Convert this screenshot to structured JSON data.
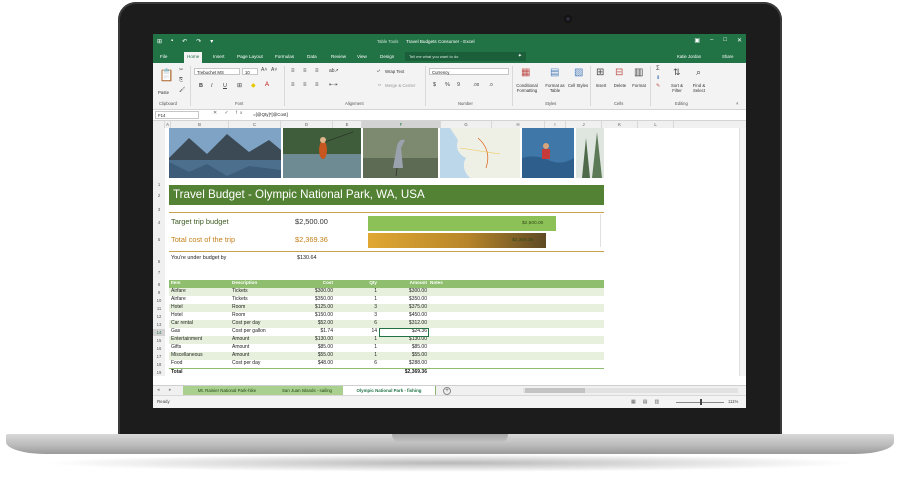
{
  "window": {
    "table_tools": "Table Tools",
    "doc_title": "Travel Budgets Consumer - Excel",
    "user": "Katie Jordan",
    "share": "Share",
    "qat": [
      "⊞",
      "▪",
      "↶",
      "↷",
      "▾"
    ],
    "win_buttons": [
      "▣",
      "–",
      "□",
      "✕"
    ]
  },
  "tabs": [
    "File",
    "Home",
    "Insert",
    "Page Layout",
    "Formulas",
    "Data",
    "Review",
    "View",
    "Design"
  ],
  "active_tab": "Home",
  "tell_me": "Tell me what you want to do",
  "ribbon": {
    "paste": "Paste",
    "font_name": "Trebuchet MS",
    "font_size": "10",
    "font_buttons": [
      "B",
      "I",
      "U"
    ],
    "align_icons": [
      "≡",
      "≡",
      "≡"
    ],
    "wrap_text": "Wrap Text",
    "merge_center": "Merge & Center",
    "number_format": "Currency",
    "number_icons": [
      "$",
      "%",
      "9"
    ],
    "conditional": "Conditional Formatting",
    "format_table": "Format as Table",
    "cell_styles": "Cell Styles",
    "insert": "Insert",
    "delete": "Delete",
    "format": "Format",
    "sort_filter": "Sort & Filter",
    "find_select": "Find & Select",
    "groups": [
      "Clipboard",
      "Font",
      "Alignment",
      "Number",
      "Styles",
      "Cells",
      "Editing"
    ]
  },
  "formula_bar": {
    "name_box": "F14",
    "fx_icons": "✕ ✓ fx",
    "formula": "=[@Qty]*[@Cost]"
  },
  "columns": [
    "A",
    "B",
    "C",
    "D",
    "E",
    "F",
    "G",
    "H",
    "I",
    "J",
    "K",
    "L"
  ],
  "rows": [
    "1",
    "2",
    "3",
    "4",
    "5",
    "6",
    "7",
    "8",
    "9",
    "10",
    "11",
    "12",
    "13",
    "14",
    "15",
    "16",
    "17",
    "18",
    "19"
  ],
  "banner_title": "Travel Budget - Olympic National Park, WA, USA",
  "summary": {
    "target_label": "Target trip budget",
    "target_value": "$2,500.00",
    "total_label": "Total cost of the trip",
    "total_value": "$2,369.36",
    "under_label": "You're under budget by",
    "under_value": "$130.64",
    "bars": [
      {
        "label": "$2,500.00",
        "fraction": 1.0,
        "color": "#8cc157"
      },
      {
        "label": "$2,369.36",
        "fraction": 0.947,
        "color": "#e0a732"
      }
    ]
  },
  "table": {
    "headers": {
      "item": "Item",
      "desc": "Description",
      "cost": "Cost",
      "qty": "Qty",
      "amt": "Amount",
      "notes": "Notes"
    },
    "rows": [
      {
        "item": "Airfare",
        "desc": "Tickets",
        "cost": "$300.00",
        "qty": "1",
        "amt": "$300.00"
      },
      {
        "item": "Airfare",
        "desc": "Tickets",
        "cost": "$350.00",
        "qty": "1",
        "amt": "$350.00"
      },
      {
        "item": "Hotel",
        "desc": "Room",
        "cost": "$125.00",
        "qty": "3",
        "amt": "$375.00"
      },
      {
        "item": "Hotel",
        "desc": "Room",
        "cost": "$150.00",
        "qty": "3",
        "amt": "$450.00"
      },
      {
        "item": "Car rental",
        "desc": "Cost per day",
        "cost": "$52.00",
        "qty": "6",
        "amt": "$312.00"
      },
      {
        "item": "Gas",
        "desc": "Cost per gallon",
        "cost": "$1.74",
        "qty": "14",
        "amt": "$24.36"
      },
      {
        "item": "Entertainment",
        "desc": "Amount",
        "cost": "$130.00",
        "qty": "1",
        "amt": "$130.00"
      },
      {
        "item": "Gifts",
        "desc": "Amount",
        "cost": "$85.00",
        "qty": "1",
        "amt": "$85.00"
      },
      {
        "item": "Miscellaneous",
        "desc": "Amount",
        "cost": "$55.00",
        "qty": "1",
        "amt": "$55.00"
      },
      {
        "item": "Food",
        "desc": "Cost per day",
        "cost": "$48.00",
        "qty": "6",
        "amt": "$288.00"
      }
    ],
    "total": {
      "item": "Total",
      "amt": "$2,369.36"
    }
  },
  "sheet_tabs": [
    "Mt. Rainier National Park-hike",
    "San Juan Islands - sailing",
    "Olympic National Park - fishing"
  ],
  "active_sheet": "Olympic National Park - fishing",
  "sheet_nav": "◂ ▸",
  "add_sheet": "+",
  "status": "Ready",
  "view_icons": [
    "▦",
    "▤",
    "▥"
  ],
  "zoom": "111%"
}
